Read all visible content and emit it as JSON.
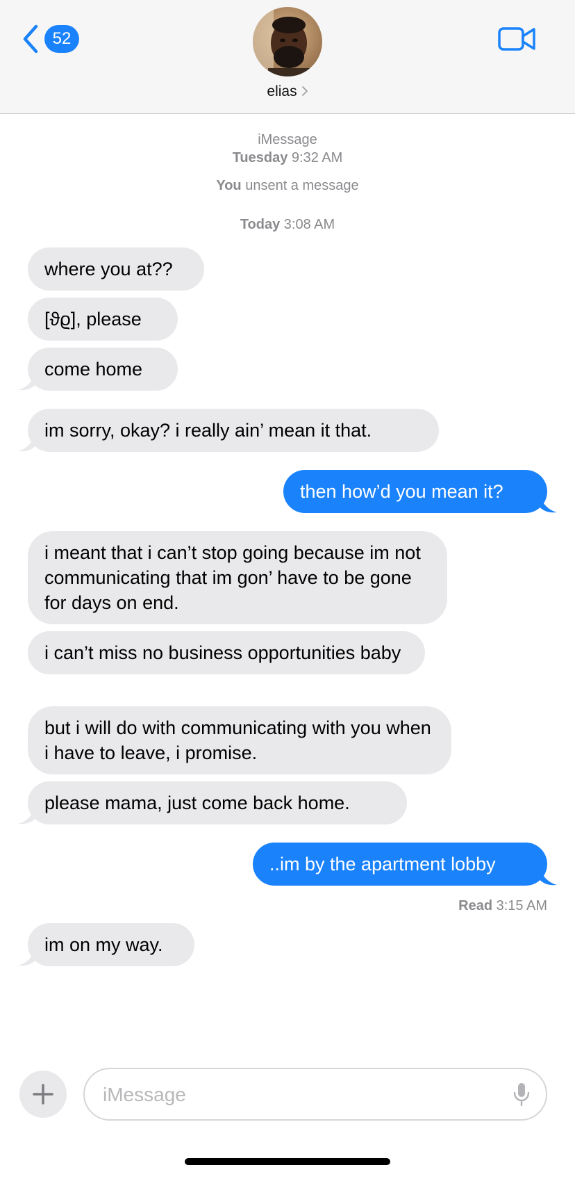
{
  "header": {
    "back_badge": "52",
    "contact_name": "elias"
  },
  "thread_info": {
    "service": "iMessage",
    "first_timestamp_day": "Tuesday",
    "first_timestamp_time": "9:32 AM",
    "unsent_actor": "You",
    "unsent_text": "unsent a message",
    "second_timestamp_day": "Today",
    "second_timestamp_time": "3:08 AM"
  },
  "messages": [
    {
      "direction": "received",
      "text": "where you at??"
    },
    {
      "direction": "received",
      "text": "[ϑϱ], please"
    },
    {
      "direction": "received",
      "text": "come home"
    },
    {
      "direction": "received",
      "text": "im sorry, okay? i really ain’ mean it that."
    },
    {
      "direction": "sent",
      "text": "then how’d you mean it?"
    },
    {
      "direction": "received",
      "text": "i meant that i can’t stop going because im not communicating that im gon’ have to be gone for days on end."
    },
    {
      "direction": "received",
      "text": "i can’t miss no business opportunities baby"
    },
    {
      "direction": "received",
      "text": "but i will do with communicating with you when i have to leave, i promise."
    },
    {
      "direction": "received",
      "text": "please mama, just come back home."
    },
    {
      "direction": "sent",
      "text": "..im by the apartment lobby"
    },
    {
      "direction": "received",
      "text": "im on my way."
    }
  ],
  "read_receipt": {
    "label": "Read",
    "time": "3:15 AM"
  },
  "composer": {
    "placeholder": "iMessage",
    "value": ""
  },
  "colors": {
    "accent": "#1a82fb",
    "received_bubble": "#e9e9eb",
    "header_bg": "#f6f6f6",
    "meta_text": "#8a8a8e"
  },
  "icons": {
    "back": "chevron-left-icon",
    "video": "video-camera-icon",
    "plus": "plus-icon",
    "mic": "microphone-icon"
  }
}
